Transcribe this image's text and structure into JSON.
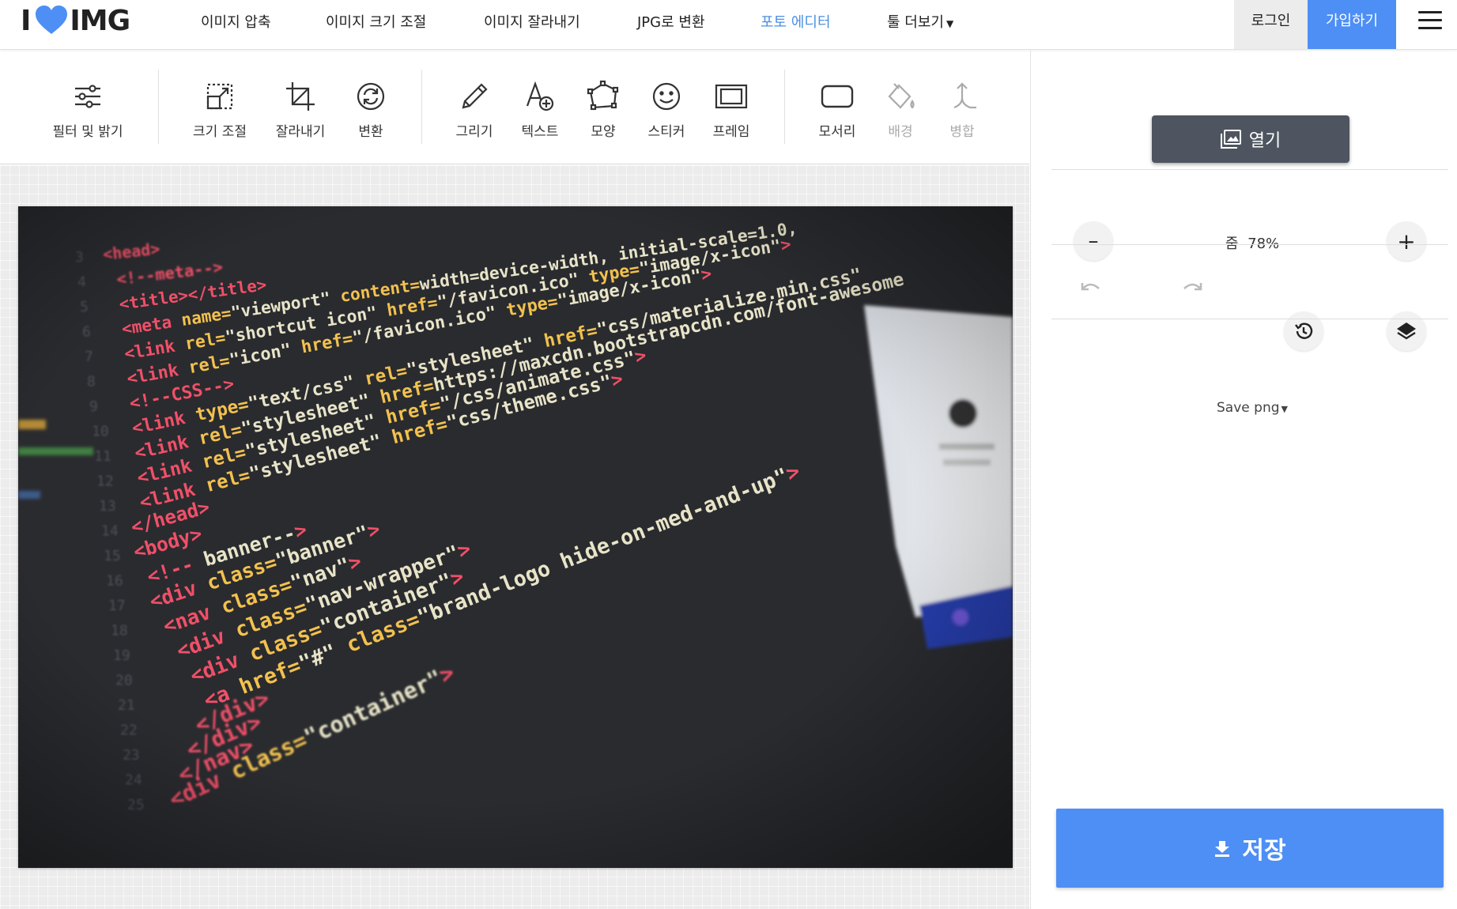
{
  "brand": {
    "logo_left": "I",
    "logo_right": "IMG",
    "heart_color": "#4d8ff5"
  },
  "nav": {
    "items": [
      {
        "label": "이미지 압축"
      },
      {
        "label": "이미지 크기 조절"
      },
      {
        "label": "이미지 잘라내기"
      },
      {
        "label": "JPG로 변환"
      },
      {
        "label": "포토 에디터",
        "active": true
      },
      {
        "label": "툴 더보기",
        "dropdown": true
      }
    ],
    "login_label": "로그인",
    "signup_label": "가입하기",
    "menu_icon": "hamburger-icon",
    "accent_color": "#4a90e2"
  },
  "tools": [
    {
      "label": "필터 및 밝기",
      "icon": "filter-sliders-icon"
    },
    {
      "label": "크기 조절",
      "icon": "resize-icon"
    },
    {
      "label": "잘라내기",
      "icon": "crop-icon"
    },
    {
      "label": "변환",
      "icon": "transform-icon"
    },
    {
      "label": "그리기",
      "icon": "pencil-icon"
    },
    {
      "label": "텍스트",
      "icon": "text-add-icon"
    },
    {
      "label": "모양",
      "icon": "shape-icon"
    },
    {
      "label": "스티커",
      "icon": "smiley-icon"
    },
    {
      "label": "프레임",
      "icon": "frame-icon"
    },
    {
      "label": "모서리",
      "icon": "rounded-corner-icon"
    },
    {
      "label": "배경",
      "icon": "paint-bucket-icon",
      "disabled": true
    },
    {
      "label": "병합",
      "icon": "merge-icon",
      "disabled": true
    }
  ],
  "sidebar": {
    "open_label": "열기",
    "zoom": {
      "label": "줌",
      "value": "78%",
      "decrease_symbol": "–",
      "increase_symbol": "+"
    },
    "history_icons": [
      "undo-icon",
      "redo-icon",
      "history-icon",
      "layers-icon"
    ],
    "save_format": "Save png",
    "save_label": "저장",
    "save_color": "#4d8ff5"
  },
  "photo": {
    "description_icon": "code-screenshot-image",
    "code_lines": [
      "<head>",
      "<!--meta-->",
      "<title></title>",
      "<meta name=\"viewport\" content=\"width=device-width, initial-scale=1.0,",
      "<link rel=\"shortcut icon\" href=\"/favicon.ico\" type=\"image/x-icon\">",
      "<link rel=\"icon\" href=\"/favicon.ico\" type=\"image/x-icon\">",
      "<!--CSS-->",
      "<link type=\"text/css\" rel=\"stylesheet\" href=\"css/materialize.min.css\"",
      "<link rel=\"stylesheet\" href=\"https://maxcdn.bootstrapcdn.com/font-awesome",
      "<link rel=\"stylesheet\" href=\"/css/animate.css\">",
      "<link rel=\"stylesheet\" href=\"css/theme.css\">",
      "</head>",
      "<body>",
      "<!-- banner-->",
      "<div class=\"banner\">",
      "<nav class=\"nav\">",
      "<div class=\"nav-wrapper\">",
      "<div class=\"container\">",
      "<a href=\"#\" class=\"brand-logo hide-on-med-and-up\">",
      "</div>",
      "</div>",
      "</nav>",
      "<div class=\"container\">"
    ]
  }
}
